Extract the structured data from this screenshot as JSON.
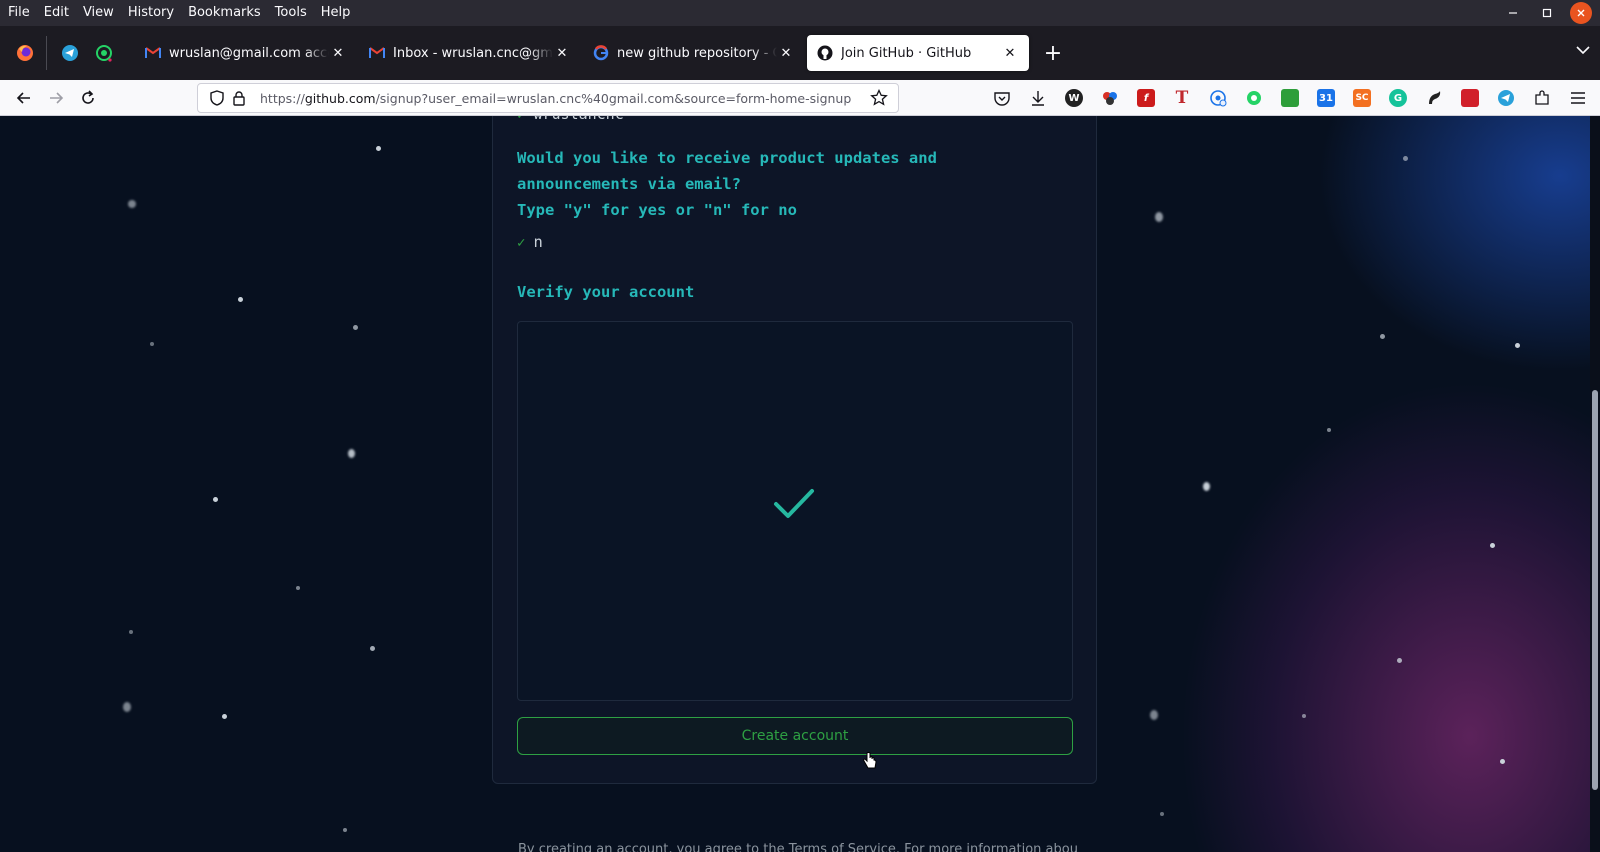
{
  "menu": [
    "File",
    "Edit",
    "View",
    "History",
    "Bookmarks",
    "Tools",
    "Help"
  ],
  "tabs": [
    {
      "title": "wruslan@gmail.com account d",
      "favicon": "gmail-icon",
      "active": false
    },
    {
      "title": "Inbox - wruslan.cnc@gmail.com",
      "favicon": "gmail-icon",
      "active": false
    },
    {
      "title": "new github repository - Google",
      "favicon": "google-icon",
      "active": false
    },
    {
      "title": "Join GitHub · GitHub",
      "favicon": "github-icon",
      "active": true
    }
  ],
  "pinned_tabs": [
    "firefox-icon",
    "telegram-icon",
    "whatsapp-icon"
  ],
  "url": {
    "prefix": "https://",
    "domain": "github.com",
    "path": "/signup?user_email=wruslan.cnc%40gmail.com&source=form-home-signup"
  },
  "extensions": [
    {
      "name": "pocket-icon",
      "label": ""
    },
    {
      "name": "download-icon",
      "label": ""
    },
    {
      "name": "wikipedia-extension-icon",
      "label": "W",
      "color": "#222222"
    },
    {
      "name": "colorful-extension-icon",
      "label": "",
      "color": "#3a3a3a"
    },
    {
      "name": "flash-extension-icon",
      "label": "f",
      "color": "#cc1b1b"
    },
    {
      "name": "t-extension-icon",
      "label": "T",
      "color": "#c0282d"
    },
    {
      "name": "globe-extension-icon",
      "label": "",
      "color": "#1a73e8"
    },
    {
      "name": "whatsapp-extension-icon",
      "label": "",
      "color": "#25d366"
    },
    {
      "name": "cash-extension-icon",
      "label": "",
      "color": "#2e9e3a"
    },
    {
      "name": "calendar-extension-icon",
      "label": "31",
      "color": "#1a73e8"
    },
    {
      "name": "sc-extension-icon",
      "label": "SC",
      "color": "#f37021"
    },
    {
      "name": "grammarly-extension-icon",
      "label": "G",
      "color": "#15c39a"
    },
    {
      "name": "gnome-extension-icon",
      "label": "",
      "color": "#222222"
    },
    {
      "name": "red-extension-icon",
      "label": "",
      "color": "#d1202a"
    },
    {
      "name": "telegram-extension-icon",
      "label": "",
      "color": "#2aa1da"
    },
    {
      "name": "puzzle-extensions-icon",
      "label": ""
    },
    {
      "name": "hamburger-menu-icon",
      "label": ""
    }
  ],
  "signup": {
    "previous_answer": "wruslancnc",
    "question_line1": "Would you like to receive product updates and",
    "question_line2": "announcements via email?",
    "question_line3": "Type \"y\" for yes or \"n\" for no",
    "answer": "n",
    "verify_heading": "Verify your account",
    "create_button": "Create account",
    "footer_text": "By creating an account, you agree to the Terms of Service. For more information about GitHub's privacy practices."
  },
  "colors": {
    "accent_teal": "#26b8b8",
    "success_green": "#2ea043",
    "page_bg": "#07101f",
    "card_bg": "#0d1527"
  }
}
